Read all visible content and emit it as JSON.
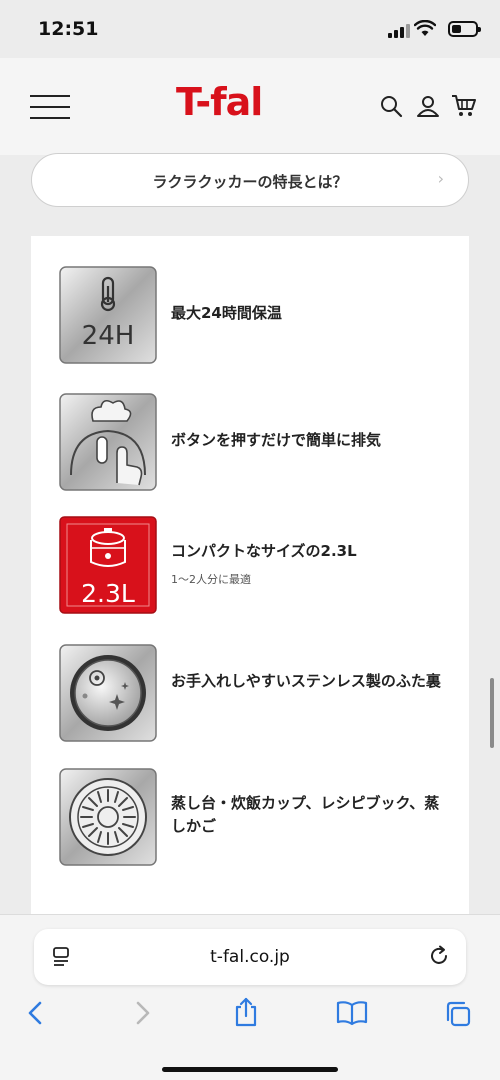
{
  "status_bar": {
    "time": "12:51"
  },
  "header": {
    "logo": "T-fal"
  },
  "pill_button": {
    "label": "ラクラクッカーの特長とは？",
    "chevron": "›"
  },
  "features": [
    {
      "icon": "thermometer-24h-icon",
      "badge": "24H",
      "title": "最大24時間保温",
      "subtitle": ""
    },
    {
      "icon": "steam-release-button-icon",
      "badge": "",
      "title": "ボタンを押すだけで簡単に排気",
      "subtitle": ""
    },
    {
      "icon": "compact-cooker-2.3l-icon",
      "badge": "2.3L",
      "title": "コンパクトなサイズの2.3L",
      "subtitle": "1〜2人分に最適"
    },
    {
      "icon": "stainless-lid-icon",
      "badge": "",
      "title": "お手入れしやすいステンレス製のふた裏",
      "subtitle": ""
    },
    {
      "icon": "steam-basket-icon",
      "badge": "",
      "title": "蒸し台・炊飯カップ、レシピブック、蒸しかご",
      "subtitle": ""
    }
  ],
  "browser": {
    "url": "t-fal.co.jp"
  },
  "colors": {
    "brand": "#d8111b",
    "accent_blue": "#2f7be0"
  }
}
